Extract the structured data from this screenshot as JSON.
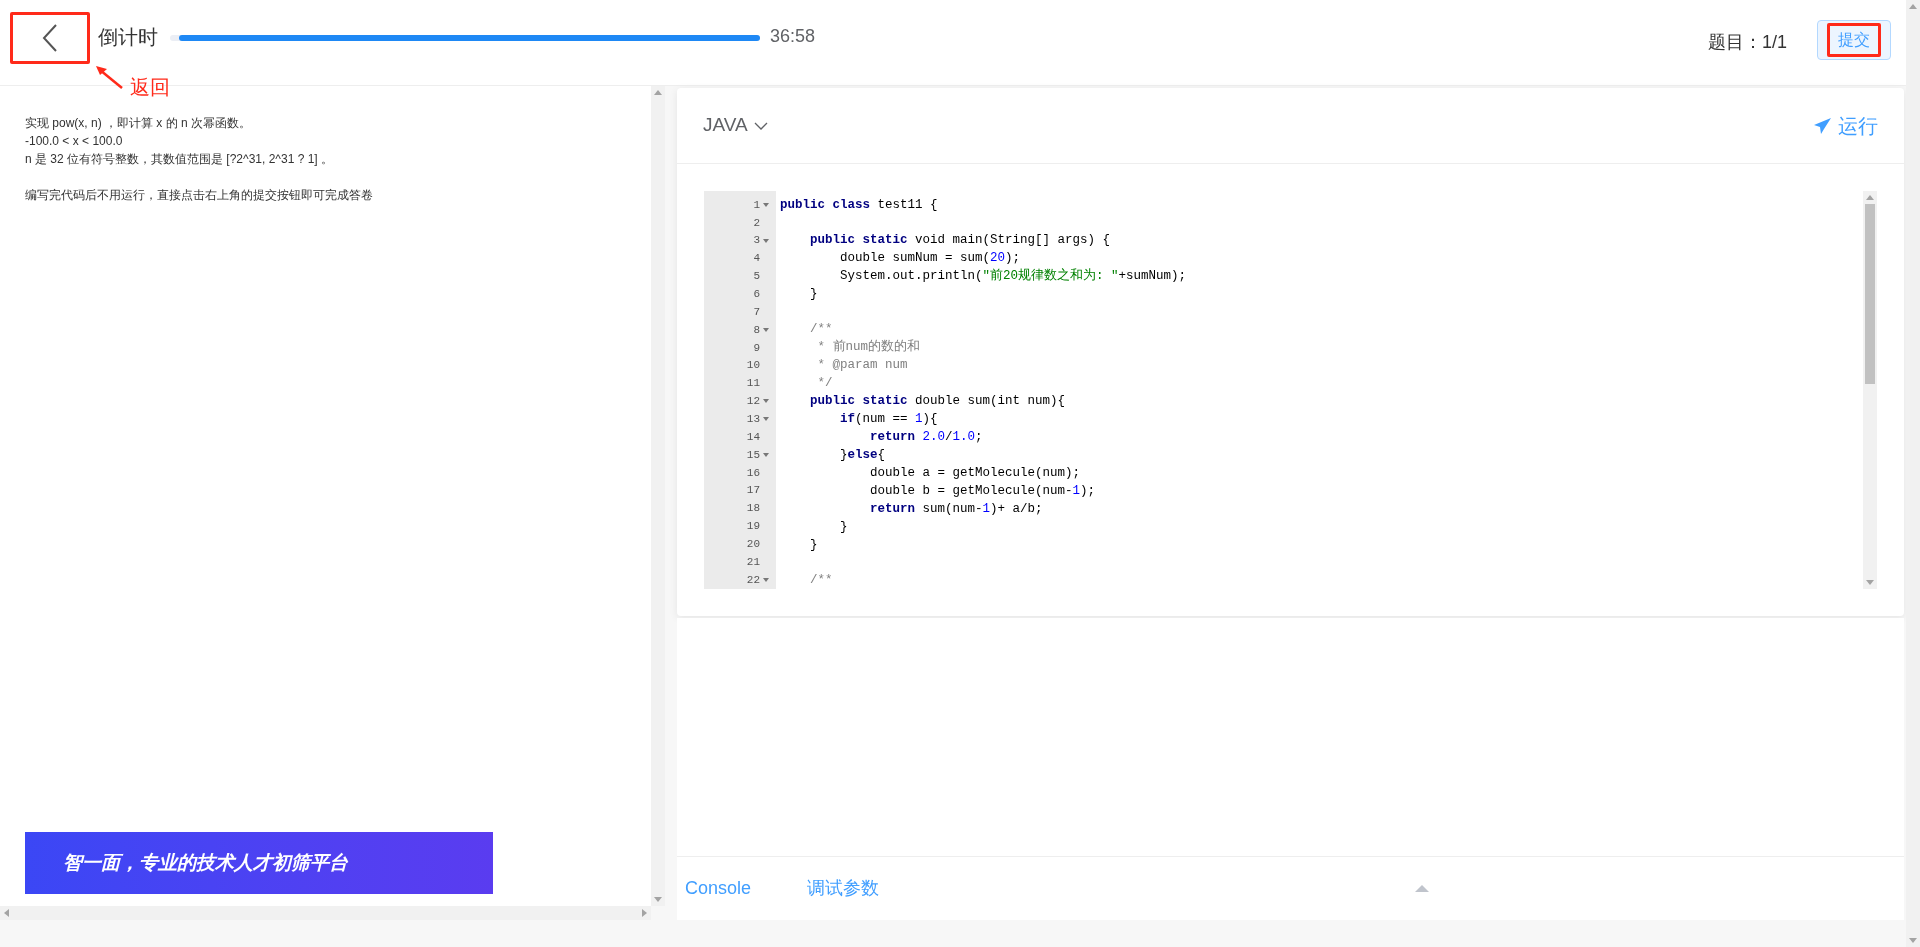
{
  "header": {
    "back_annotation": "返回",
    "timer_label": "倒计时",
    "timer": {
      "level": 0.985,
      "reading": "36:58"
    },
    "question_count": "题目：1/1",
    "submit_button": "提交"
  },
  "problem": {
    "paragraphs": [
      [
        "实现 pow(x, n) ，即计算 x 的 n 次幂函数。",
        "-100.0 < x < 100.0",
        "n 是 32 位有符号整数，其数值范围是 [?2^31, 2^31 ? 1] 。"
      ],
      [
        "编写完代码后不用运行，直接点击右上角的提交按钮即可完成答卷"
      ]
    ],
    "banner": "智一面，专业的技术人才初筛平台"
  },
  "editor": {
    "language": "JAVA",
    "run_button": "运行",
    "code": [
      {
        "number": "1",
        "fold": true,
        "tokens": [
          {
            "kind": "keyword",
            "t": "public class"
          },
          {
            "kind": "plain",
            "t": " test11 {"
          }
        ]
      },
      {
        "number": "2",
        "fold": false
      },
      {
        "number": "3",
        "fold": true,
        "tokens": [
          {
            "kind": "keyword",
            "t": "    public static"
          },
          {
            "kind": "plain",
            "t": " void main(String[] args) {"
          }
        ]
      },
      {
        "number": "4",
        "fold": false,
        "tokens": [
          {
            "kind": "plain",
            "t": "        double sumNum = sum("
          },
          {
            "kind": "number",
            "t": "20"
          },
          {
            "kind": "plain",
            "t": ");"
          }
        ]
      },
      {
        "number": "5",
        "fold": false,
        "tokens": [
          {
            "kind": "plain",
            "t": "        System.out.println("
          },
          {
            "kind": "string",
            "t": "\"前20规律数之和为: \""
          },
          {
            "kind": "plain",
            "t": "+sumNum);"
          }
        ]
      },
      {
        "number": "6",
        "fold": false,
        "tokens": [
          {
            "kind": "plain",
            "t": "    }"
          }
        ]
      },
      {
        "number": "7",
        "fold": false
      },
      {
        "number": "8",
        "fold": true,
        "tokens": [
          {
            "kind": "comment",
            "t": "    /**"
          }
        ]
      },
      {
        "number": "9",
        "fold": false,
        "tokens": [
          {
            "kind": "comment",
            "t": "     * 前num的数的和"
          }
        ]
      },
      {
        "number": "10",
        "fold": false,
        "tokens": [
          {
            "kind": "comment",
            "t": "     * @param num"
          }
        ]
      },
      {
        "number": "11",
        "fold": false,
        "tokens": [
          {
            "kind": "comment",
            "t": "     */"
          }
        ]
      },
      {
        "number": "12",
        "fold": true,
        "tokens": [
          {
            "kind": "keyword",
            "t": "    public static"
          },
          {
            "kind": "plain",
            "t": " double sum(int num){"
          }
        ]
      },
      {
        "number": "13",
        "fold": true,
        "tokens": [
          {
            "kind": "keyword",
            "t": "        if"
          },
          {
            "kind": "plain",
            "t": "(num == "
          },
          {
            "kind": "number",
            "t": "1"
          },
          {
            "kind": "plain",
            "t": "){"
          }
        ]
      },
      {
        "number": "14",
        "fold": false,
        "tokens": [
          {
            "kind": "keyword",
            "t": "            return "
          },
          {
            "kind": "number",
            "t": "2.0"
          },
          {
            "kind": "plain",
            "t": "/"
          },
          {
            "kind": "number",
            "t": "1.0"
          },
          {
            "kind": "plain",
            "t": ";"
          }
        ]
      },
      {
        "number": "15",
        "fold": true,
        "tokens": [
          {
            "kind": "plain",
            "t": "        }"
          },
          {
            "kind": "keyword",
            "t": "else"
          },
          {
            "kind": "plain",
            "t": "{"
          }
        ]
      },
      {
        "number": "16",
        "fold": false,
        "tokens": [
          {
            "kind": "plain",
            "t": "            double a = getMolecule(num);"
          }
        ]
      },
      {
        "number": "17",
        "fold": false,
        "tokens": [
          {
            "kind": "plain",
            "t": "            double b = getMolecule(num-"
          },
          {
            "kind": "number",
            "t": "1"
          },
          {
            "kind": "plain",
            "t": ");"
          }
        ]
      },
      {
        "number": "18",
        "fold": false,
        "tokens": [
          {
            "kind": "keyword",
            "t": "            return"
          },
          {
            "kind": "plain",
            "t": " sum(num-"
          },
          {
            "kind": "number",
            "t": "1"
          },
          {
            "kind": "plain",
            "t": ")+ a/b;"
          }
        ]
      },
      {
        "number": "19",
        "fold": false,
        "tokens": [
          {
            "kind": "plain",
            "t": "        }"
          }
        ]
      },
      {
        "number": "20",
        "fold": false,
        "tokens": [
          {
            "kind": "plain",
            "t": "    }"
          }
        ]
      },
      {
        "number": "21",
        "fold": false
      },
      {
        "number": "22",
        "fold": true,
        "tokens": [
          {
            "kind": "comment",
            "t": "    /**"
          }
        ]
      }
    ]
  },
  "console": {
    "tabs": [
      {
        "label": "Console"
      },
      {
        "label": "调试参数"
      }
    ]
  }
}
